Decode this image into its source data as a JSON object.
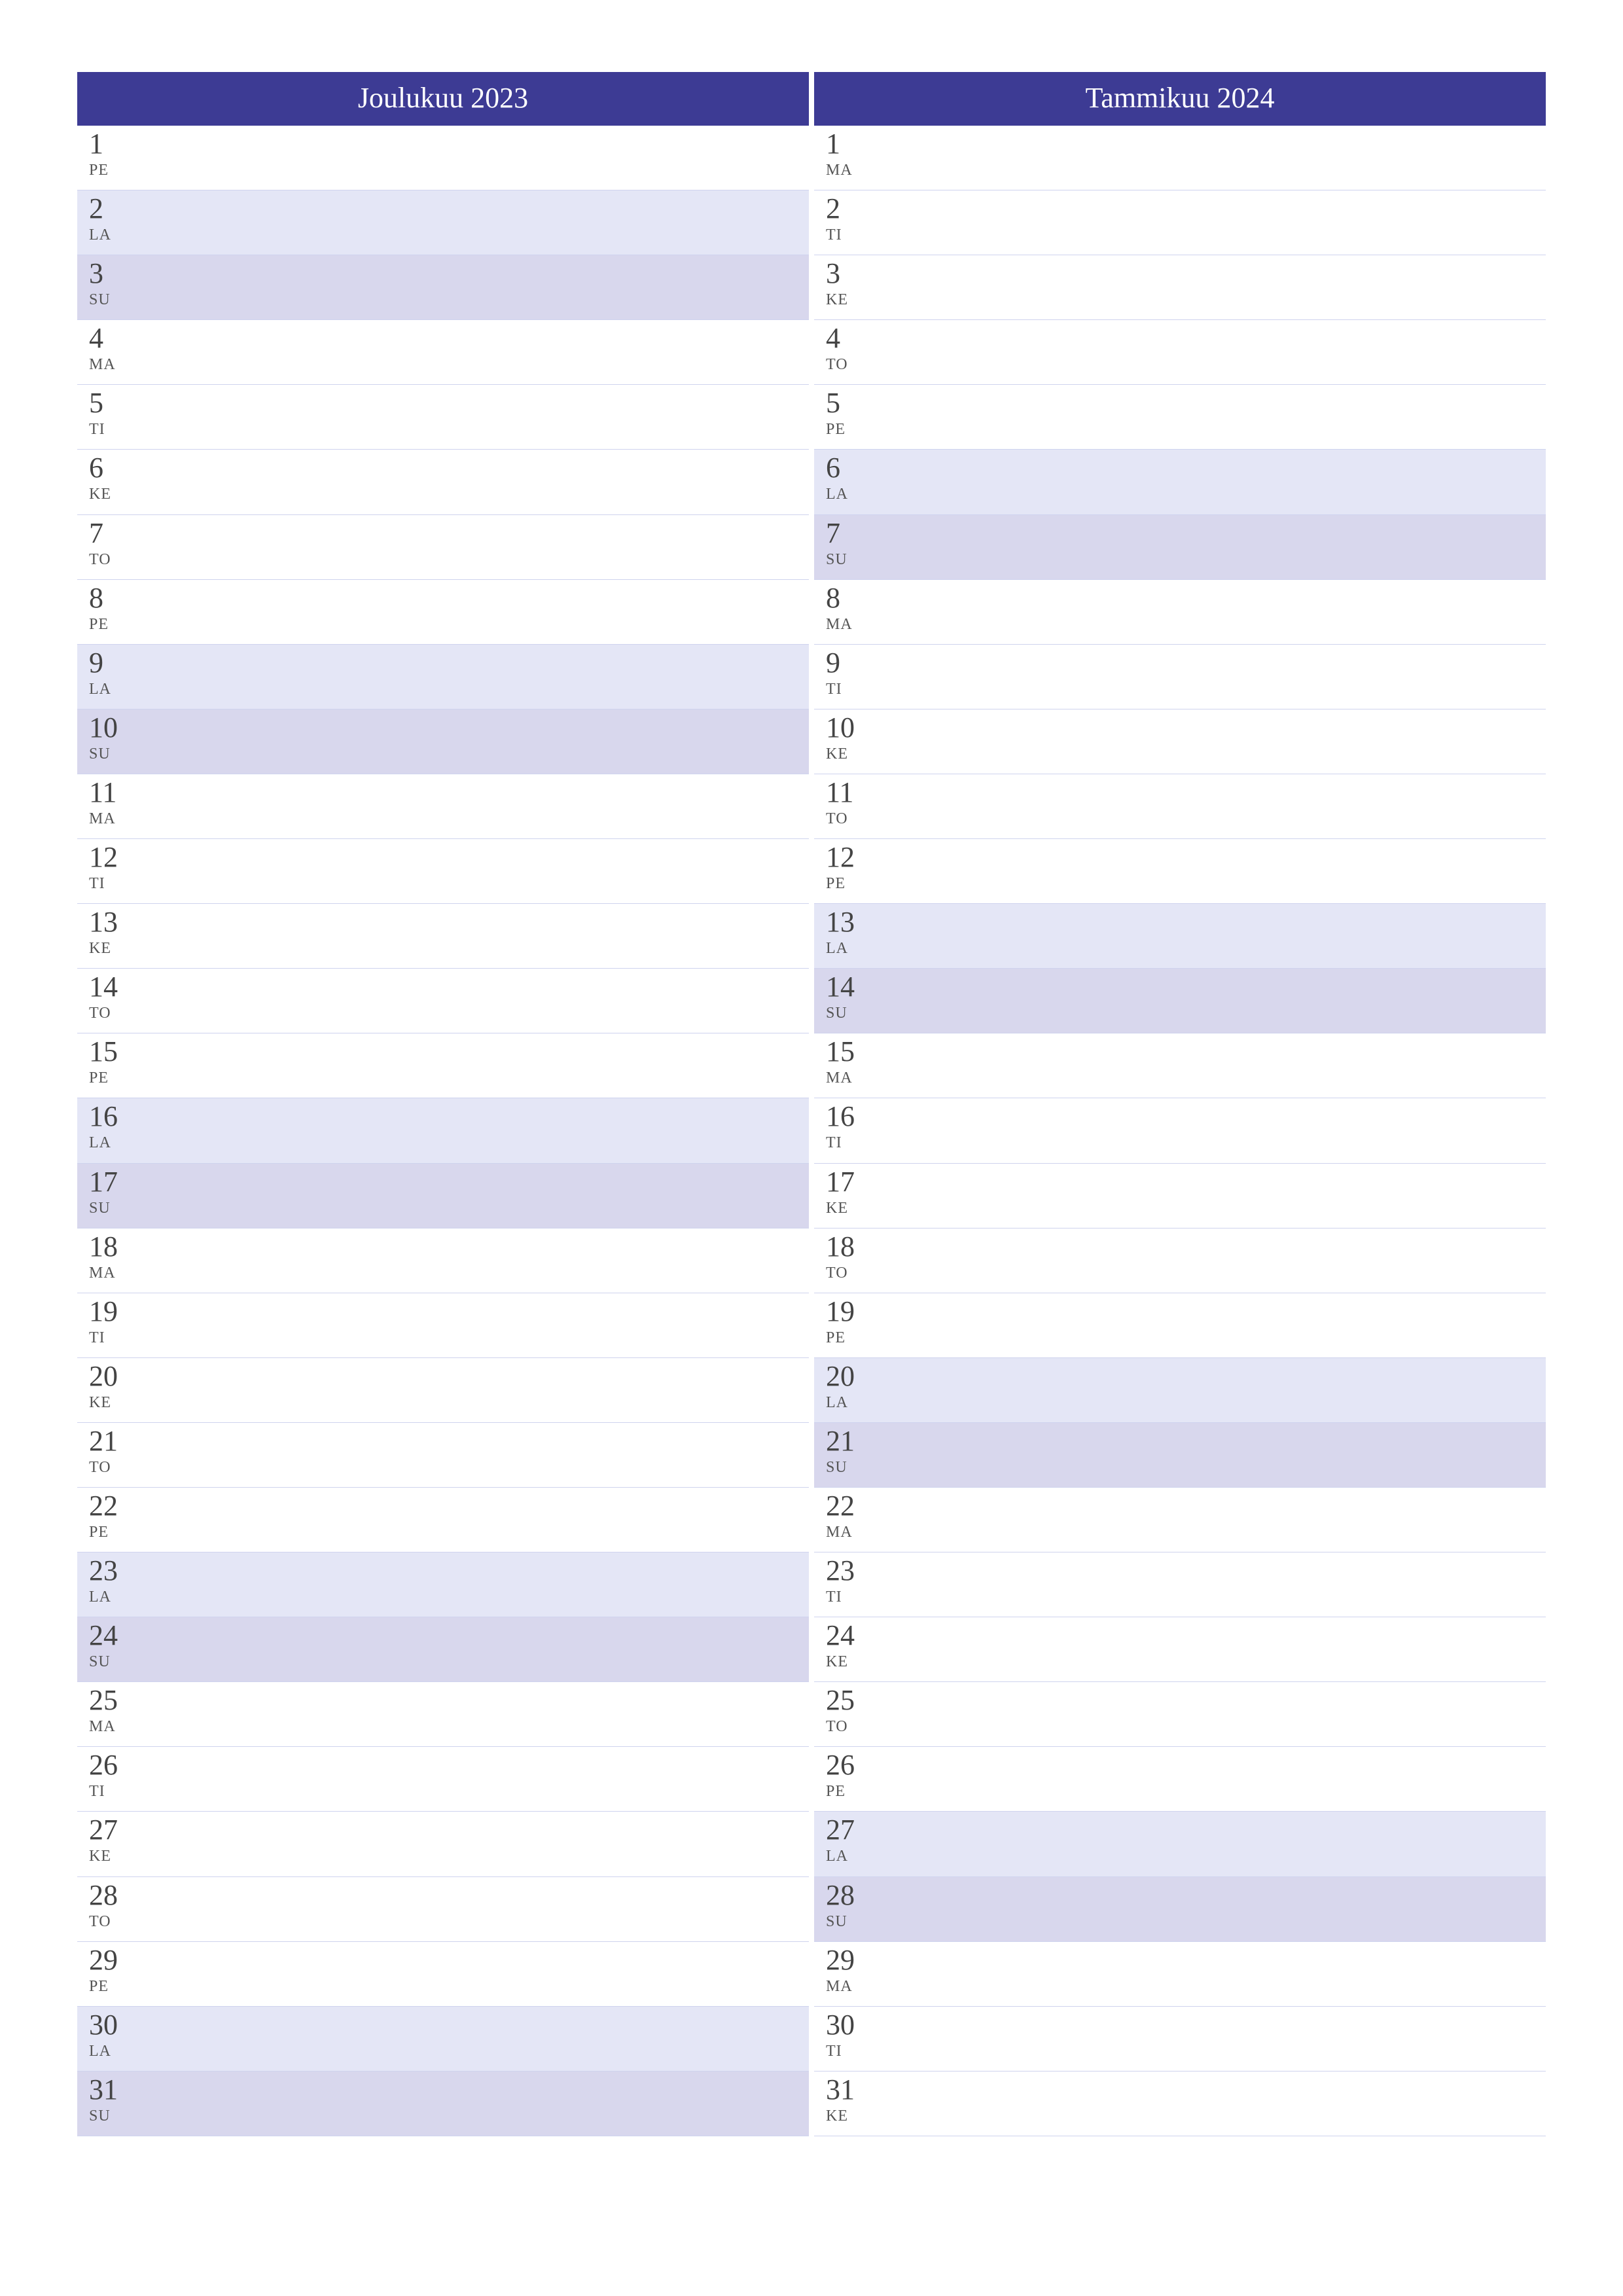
{
  "months": [
    {
      "title": "Joulukuu 2023",
      "days": [
        {
          "n": "1",
          "wd": "PE",
          "t": "wk"
        },
        {
          "n": "2",
          "wd": "LA",
          "t": "sat"
        },
        {
          "n": "3",
          "wd": "SU",
          "t": "sun"
        },
        {
          "n": "4",
          "wd": "MA",
          "t": "wk"
        },
        {
          "n": "5",
          "wd": "TI",
          "t": "wk"
        },
        {
          "n": "6",
          "wd": "KE",
          "t": "wk"
        },
        {
          "n": "7",
          "wd": "TO",
          "t": "wk"
        },
        {
          "n": "8",
          "wd": "PE",
          "t": "wk"
        },
        {
          "n": "9",
          "wd": "LA",
          "t": "sat"
        },
        {
          "n": "10",
          "wd": "SU",
          "t": "sun"
        },
        {
          "n": "11",
          "wd": "MA",
          "t": "wk"
        },
        {
          "n": "12",
          "wd": "TI",
          "t": "wk"
        },
        {
          "n": "13",
          "wd": "KE",
          "t": "wk"
        },
        {
          "n": "14",
          "wd": "TO",
          "t": "wk"
        },
        {
          "n": "15",
          "wd": "PE",
          "t": "wk"
        },
        {
          "n": "16",
          "wd": "LA",
          "t": "sat"
        },
        {
          "n": "17",
          "wd": "SU",
          "t": "sun"
        },
        {
          "n": "18",
          "wd": "MA",
          "t": "wk"
        },
        {
          "n": "19",
          "wd": "TI",
          "t": "wk"
        },
        {
          "n": "20",
          "wd": "KE",
          "t": "wk"
        },
        {
          "n": "21",
          "wd": "TO",
          "t": "wk"
        },
        {
          "n": "22",
          "wd": "PE",
          "t": "wk"
        },
        {
          "n": "23",
          "wd": "LA",
          "t": "sat"
        },
        {
          "n": "24",
          "wd": "SU",
          "t": "sun"
        },
        {
          "n": "25",
          "wd": "MA",
          "t": "wk"
        },
        {
          "n": "26",
          "wd": "TI",
          "t": "wk"
        },
        {
          "n": "27",
          "wd": "KE",
          "t": "wk"
        },
        {
          "n": "28",
          "wd": "TO",
          "t": "wk"
        },
        {
          "n": "29",
          "wd": "PE",
          "t": "wk"
        },
        {
          "n": "30",
          "wd": "LA",
          "t": "sat"
        },
        {
          "n": "31",
          "wd": "SU",
          "t": "sun"
        }
      ]
    },
    {
      "title": "Tammikuu 2024",
      "days": [
        {
          "n": "1",
          "wd": "MA",
          "t": "wk"
        },
        {
          "n": "2",
          "wd": "TI",
          "t": "wk"
        },
        {
          "n": "3",
          "wd": "KE",
          "t": "wk"
        },
        {
          "n": "4",
          "wd": "TO",
          "t": "wk"
        },
        {
          "n": "5",
          "wd": "PE",
          "t": "wk"
        },
        {
          "n": "6",
          "wd": "LA",
          "t": "sat"
        },
        {
          "n": "7",
          "wd": "SU",
          "t": "sun"
        },
        {
          "n": "8",
          "wd": "MA",
          "t": "wk"
        },
        {
          "n": "9",
          "wd": "TI",
          "t": "wk"
        },
        {
          "n": "10",
          "wd": "KE",
          "t": "wk"
        },
        {
          "n": "11",
          "wd": "TO",
          "t": "wk"
        },
        {
          "n": "12",
          "wd": "PE",
          "t": "wk"
        },
        {
          "n": "13",
          "wd": "LA",
          "t": "sat"
        },
        {
          "n": "14",
          "wd": "SU",
          "t": "sun"
        },
        {
          "n": "15",
          "wd": "MA",
          "t": "wk"
        },
        {
          "n": "16",
          "wd": "TI",
          "t": "wk"
        },
        {
          "n": "17",
          "wd": "KE",
          "t": "wk"
        },
        {
          "n": "18",
          "wd": "TO",
          "t": "wk"
        },
        {
          "n": "19",
          "wd": "PE",
          "t": "wk"
        },
        {
          "n": "20",
          "wd": "LA",
          "t": "sat"
        },
        {
          "n": "21",
          "wd": "SU",
          "t": "sun"
        },
        {
          "n": "22",
          "wd": "MA",
          "t": "wk"
        },
        {
          "n": "23",
          "wd": "TI",
          "t": "wk"
        },
        {
          "n": "24",
          "wd": "KE",
          "t": "wk"
        },
        {
          "n": "25",
          "wd": "TO",
          "t": "wk"
        },
        {
          "n": "26",
          "wd": "PE",
          "t": "wk"
        },
        {
          "n": "27",
          "wd": "LA",
          "t": "sat"
        },
        {
          "n": "28",
          "wd": "SU",
          "t": "sun"
        },
        {
          "n": "29",
          "wd": "MA",
          "t": "wk"
        },
        {
          "n": "30",
          "wd": "TI",
          "t": "wk"
        },
        {
          "n": "31",
          "wd": "KE",
          "t": "wk"
        }
      ]
    }
  ]
}
